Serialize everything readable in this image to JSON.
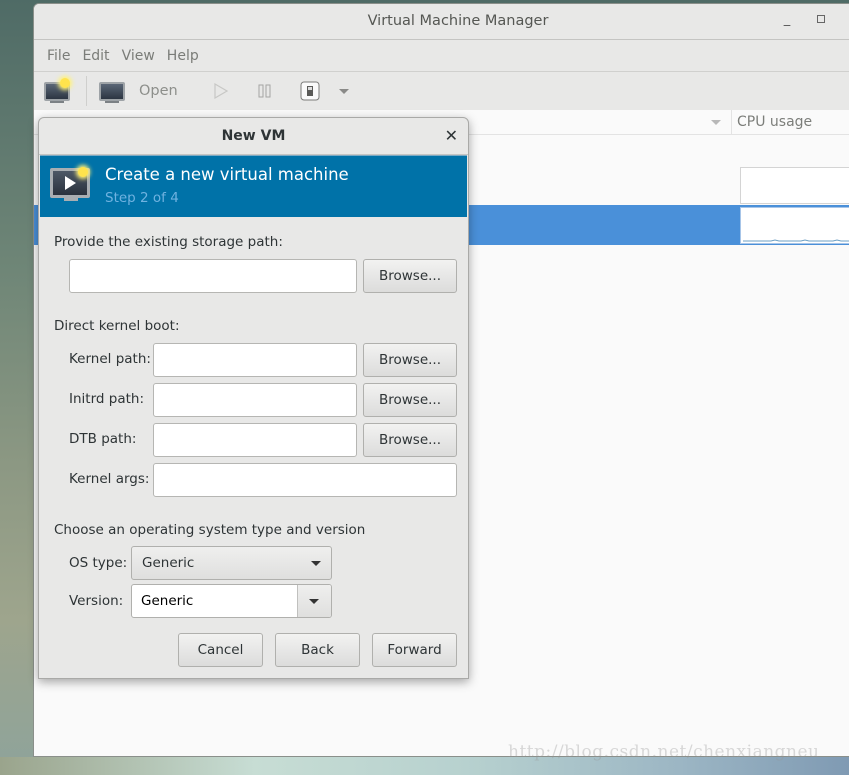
{
  "window": {
    "title": "Virtual Machine Manager",
    "minimize_icon": "minimize-icon",
    "maximize_icon": "maximize-icon"
  },
  "menubar": {
    "items": [
      {
        "label": "File"
      },
      {
        "label": "Edit"
      },
      {
        "label": "View"
      },
      {
        "label": "Help"
      }
    ]
  },
  "toolbar": {
    "new_vm_icon": "new-vm-icon",
    "open_label": "Open",
    "open_icon": "monitor-icon",
    "run_icon": "play-icon",
    "pause_icon": "pause-icon",
    "shutdown_icon": "power-icon",
    "menu_icon": "dropdown-arrow-icon"
  },
  "vm_list": {
    "columns": [
      {
        "label": "CPU usage"
      }
    ],
    "selected_row": 2,
    "accent_color": "#4a90d9"
  },
  "dialog": {
    "title": "New VM",
    "close_icon": "close-icon",
    "banner": {
      "heading": "Create a new virtual machine",
      "step": "Step 2 of 4",
      "color": "#0072a8"
    },
    "storage": {
      "label": "Provide the existing storage path:",
      "value": "",
      "browse_label": "Browse..."
    },
    "kernel_boot": {
      "label": "Direct kernel boot:",
      "fields": [
        {
          "label": "Kernel path:",
          "value": "",
          "browse_label": "Browse..."
        },
        {
          "label": "Initrd path:",
          "value": "",
          "browse_label": "Browse..."
        },
        {
          "label": "DTB path:",
          "value": "",
          "browse_label": "Browse..."
        },
        {
          "label": "Kernel args:",
          "value": ""
        }
      ]
    },
    "os": {
      "label": "Choose an operating system type and version",
      "type_label": "OS type:",
      "type_value": "Generic",
      "version_label": "Version:",
      "version_value": "Generic"
    },
    "buttons": {
      "cancel": "Cancel",
      "back": "Back",
      "forward": "Forward"
    }
  },
  "watermark": "http://blog.csdn.net/chenxiangneu"
}
